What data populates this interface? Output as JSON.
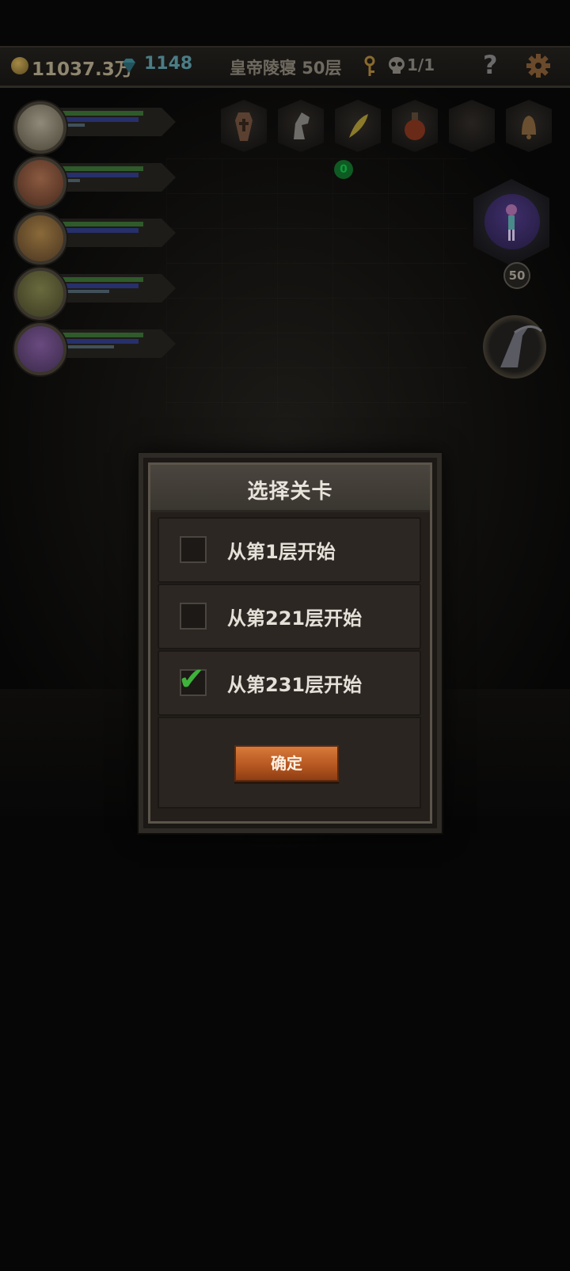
{
  "topbar": {
    "gold": "11037.3万",
    "gems": "1148",
    "location": "皇帝陵寝 50层",
    "kills": "1/1",
    "help": "?"
  },
  "party": [
    {
      "name": "hero-1",
      "hp": 0.85,
      "mp": 0.8,
      "xp": 0.25
    },
    {
      "name": "hero-2",
      "hp": 0.85,
      "mp": 0.8,
      "xp": 0.2
    },
    {
      "name": "hero-3",
      "hp": 0.85,
      "mp": 0.8,
      "xp": 0.05
    },
    {
      "name": "hero-4",
      "hp": 0.85,
      "mp": 0.8,
      "xp": 0.5
    },
    {
      "name": "hero-5",
      "hp": 0.85,
      "mp": 0.8,
      "xp": 0.55
    }
  ],
  "items": [
    "coffin-icon",
    "horse-head-icon",
    "feather-icon",
    "potion-icon",
    "empty-slot",
    "bell-icon"
  ],
  "item_badge": "0",
  "boss": {
    "level": "50"
  },
  "dialog": {
    "title": "选择关卡",
    "options": [
      {
        "label": "从第1层开始",
        "checked": false
      },
      {
        "label": "从第221层开始",
        "checked": false
      },
      {
        "label": "从第231层开始",
        "checked": true
      }
    ],
    "confirm": "确定"
  },
  "colors": {
    "accent": "#c4642a",
    "check": "#3fb23b"
  }
}
